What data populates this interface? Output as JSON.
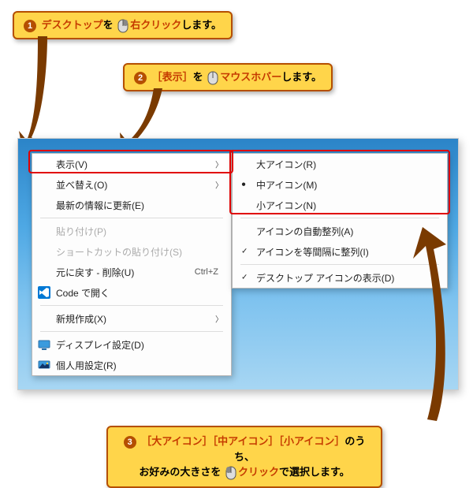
{
  "callouts": {
    "c1": {
      "num": "1",
      "p1": "デスクトップ",
      "p2": "を",
      "p3": "右クリック",
      "p4": "します。"
    },
    "c2": {
      "num": "2",
      "p1": "［表示］",
      "p2": "を",
      "p3": "マウスホバー",
      "p4": "します。"
    },
    "c3": {
      "num": "3",
      "l1a": "［大アイコン］［中アイコン］［小アイコン］",
      "l1b": "のうち、",
      "l2a": "お好みの大きさを",
      "l2b": "クリック",
      "l2c": "で選択します。"
    }
  },
  "menu1": {
    "items": [
      {
        "label": "表示(V)",
        "sub": true
      },
      {
        "label": "並べ替え(O)",
        "sub": true
      },
      {
        "label": "最新の情報に更新(E)"
      }
    ],
    "items2": [
      {
        "label": "貼り付け(P)",
        "disabled": true
      },
      {
        "label": "ショートカットの貼り付け(S)",
        "disabled": true
      },
      {
        "label": "元に戻す - 削除(U)",
        "shortcut": "Ctrl+Z"
      },
      {
        "label": "Code で開く",
        "icon": "vscode"
      }
    ],
    "items3": [
      {
        "label": "新規作成(X)",
        "sub": true
      }
    ],
    "items4": [
      {
        "label": "ディスプレイ設定(D)",
        "icon": "display"
      },
      {
        "label": "個人用設定(R)",
        "icon": "personalize"
      }
    ]
  },
  "menu2": {
    "items": [
      {
        "label": "大アイコン(R)"
      },
      {
        "label": "中アイコン(M)",
        "radio": true
      },
      {
        "label": "小アイコン(N)"
      }
    ],
    "items2": [
      {
        "label": "アイコンの自動整列(A)"
      },
      {
        "label": "アイコンを等間隔に整列(I)",
        "check": true
      }
    ],
    "items3": [
      {
        "label": "デスクトップ アイコンの表示(D)",
        "check": true
      }
    ]
  }
}
